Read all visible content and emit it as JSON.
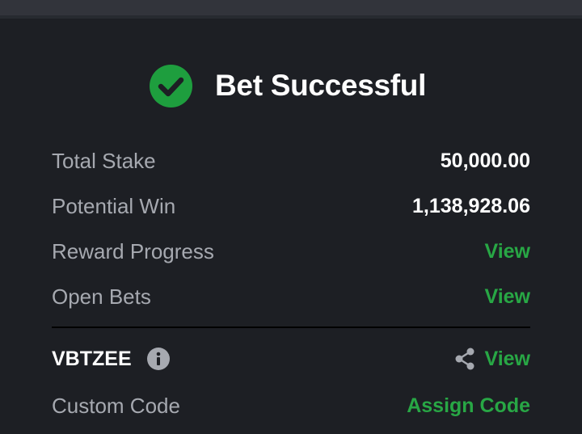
{
  "header": {
    "title": "Bet Successful",
    "icon": "check-circle-icon",
    "icon_color": "#1e9e3e"
  },
  "summary": {
    "total_stake_label": "Total Stake",
    "total_stake_value": "50,000.00",
    "potential_win_label": "Potential Win",
    "potential_win_value": "1,138,928.06",
    "reward_progress_label": "Reward Progress",
    "reward_progress_link": "View",
    "open_bets_label": "Open Bets",
    "open_bets_link": "View"
  },
  "booking": {
    "code": "VBTZEE",
    "info_icon": "info-icon",
    "share_icon": "share-icon",
    "view_link": "View",
    "custom_code_label": "Custom Code",
    "assign_code_link": "Assign Code"
  },
  "colors": {
    "background": "#1d1f24",
    "accent_green": "#28a745",
    "label_gray": "#a6a9b0"
  }
}
